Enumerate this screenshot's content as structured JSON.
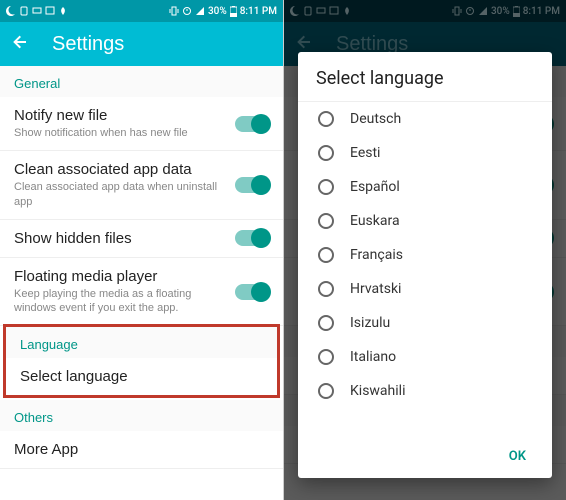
{
  "status": {
    "battery": "30%",
    "time": "8:11 PM"
  },
  "header": {
    "title": "Settings"
  },
  "sections": {
    "general": "General",
    "language": "Language",
    "others": "Others"
  },
  "rows": {
    "notify": {
      "title": "Notify new file",
      "sub": "Show notification when has new file"
    },
    "clean": {
      "title": "Clean associated app data",
      "sub": "Clean associated app data when uninstall app"
    },
    "hidden": {
      "title": "Show hidden files"
    },
    "floating": {
      "title": "Floating media player",
      "sub": "Keep playing the media as a floating windows event if you exit the app."
    },
    "selectlang": {
      "title": "Select language"
    },
    "moreapp": {
      "title": "More App"
    }
  },
  "dialog": {
    "title": "Select language",
    "ok": "OK",
    "langs": [
      "Deutsch",
      "Eesti",
      "Español",
      "Euskara",
      "Français",
      "Hrvatski",
      "Isizulu",
      "Italiano",
      "Kiswahili"
    ]
  }
}
